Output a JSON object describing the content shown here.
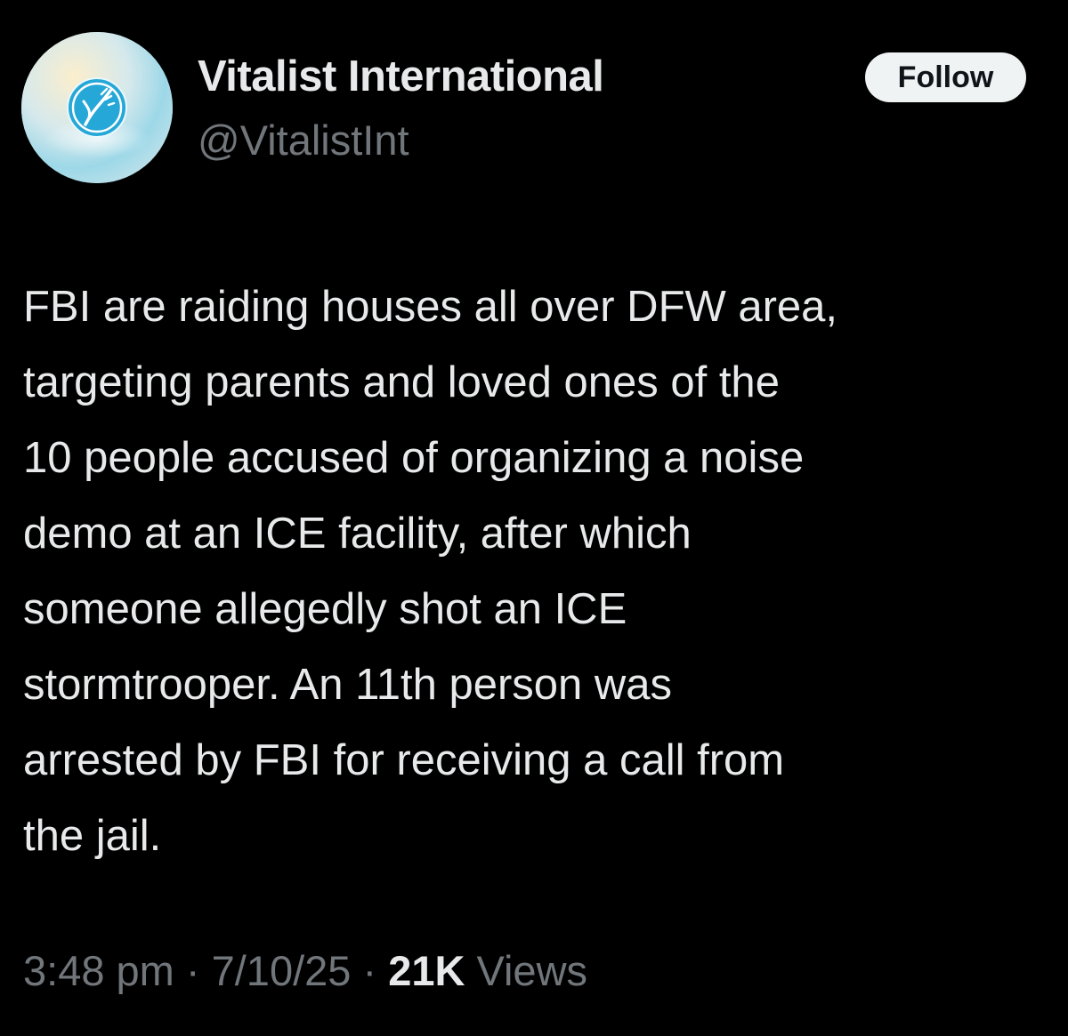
{
  "author": {
    "display_name": "Vitalist International",
    "handle": "@VitalistInt"
  },
  "follow_button": {
    "label": "Follow"
  },
  "tweet": {
    "text": "FBI are raiding houses all over DFW area,\ntargeting parents and loved ones of the\n10 people accused of organizing a noise\ndemo at an ICE facility, after which\nsomeone allegedly shot an ICE\nstormtrooper. An 11th person was\narrested by FBI for receiving a call from\nthe jail."
  },
  "meta": {
    "time": "3:48 pm",
    "separator": " · ",
    "date": "7/10/25",
    "views_count": "21K",
    "views_label": " Views"
  },
  "colors": {
    "background": "#000000",
    "primary_text": "#e7e9ea",
    "secondary_text": "#71767b",
    "button_bg": "#eff3f4"
  }
}
